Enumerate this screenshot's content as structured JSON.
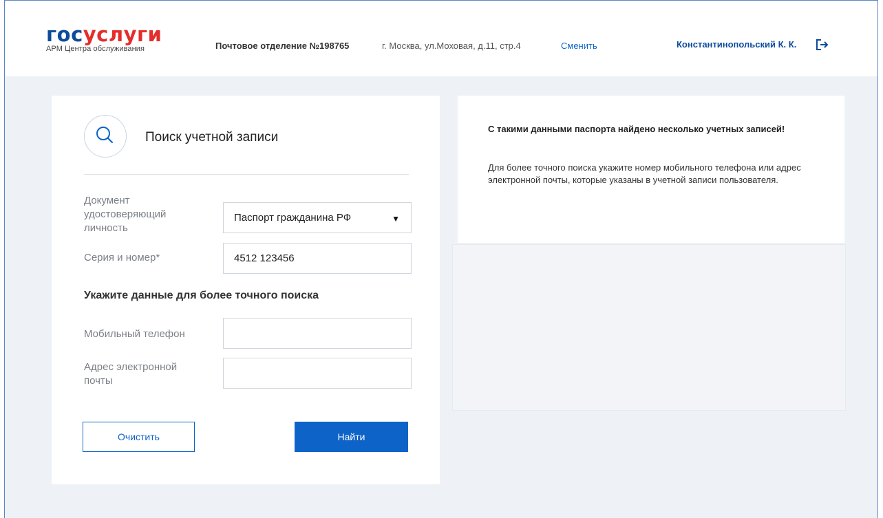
{
  "header": {
    "logo_gos": "гос",
    "logo_uslugi": "услуги",
    "logo_subtitle": "АРМ Центра обслуживания",
    "office_name": "Почтовое отделение №198765",
    "office_address": "г. Москва, ул.Моховая, д.11, стр.4",
    "change_link": "Сменить",
    "user_name": "Константинопольский К. К.",
    "logout_icon": "logout-icon"
  },
  "search": {
    "icon": "search-icon",
    "title": "Поиск учетной записи",
    "doc_label_line1": "Документ",
    "doc_label_line2": "удостоверяющий",
    "doc_label_line3": "личность",
    "doc_value": "Паспорт гражданина РФ",
    "series_label": "Серия и номер*",
    "series_value": "4512 123456",
    "refine_heading": "Укажите данные для более точного поиска",
    "phone_label": "Мобильный телефон",
    "phone_value": "",
    "email_label_line1": "Адрес электронной",
    "email_label_line2": "почты",
    "email_value": "",
    "clear_button": "Очистить",
    "find_button": "Найти"
  },
  "message": {
    "title": "С такими данными паспорта найдено несколько учетных записей!",
    "body": "Для более точного поиска укажите номер мобильного телефона или адрес электронной почты, которые указаны в учетной записи пользователя."
  },
  "colors": {
    "brand_blue": "#0d4c9b",
    "brand_red": "#e52d2b",
    "accent": "#0d63c8",
    "background": "#eef2f6"
  }
}
